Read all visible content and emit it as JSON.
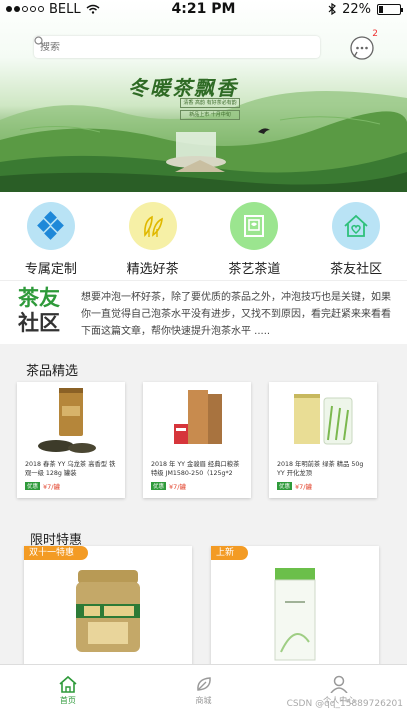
{
  "status_bar": {
    "carrier": "BELL",
    "time": "4:21 PM",
    "battery": "22%",
    "battery_level": 0.22
  },
  "search": {
    "placeholder": "搜索"
  },
  "messages": {
    "badge": "2"
  },
  "banner": {
    "title": "冬暖茶飘香",
    "subtitles": [
      "清香 高韵 有好茶必有韵",
      "新品上市 十月中旬"
    ]
  },
  "categories": [
    {
      "label": "专属定制",
      "icon": "diamond-grid-icon",
      "color": "#b9e3f5"
    },
    {
      "label": "精选好茶",
      "icon": "tea-leaf-icon",
      "color": "#f6f0a6"
    },
    {
      "label": "茶艺茶道",
      "icon": "tea-book-icon",
      "color": "#9be58f"
    },
    {
      "label": "茶友社区",
      "icon": "heart-home-icon",
      "color": "#b9e3f5"
    }
  ],
  "intro": {
    "logo_top": "茶友",
    "logo_bottom": "社区",
    "text": "想要冲泡一杯好茶，除了要优质的茶品之外，冲泡技巧也是关键，如果你一直觉得自己泡茶水平没有进步，又找不到原因，看完赶紧来来看看下面这篇文章，帮你快速提升泡茶水平 ....."
  },
  "featured": {
    "title": "茶品精选",
    "items": [
      {
        "name": "2018 春茶 YY 乌龙茶 高香型 铁观一级 128g 罐装",
        "tag": "优惠",
        "price": "¥7/罐"
      },
      {
        "name": "2018 年 YY 金骏眉 经典口粮茶特级 JM1580-250（125g*2",
        "tag": "优惠",
        "price": "¥7/罐"
      },
      {
        "name": "2018 年明前茶 绿茶 精品 50g YY 开化龙顶",
        "tag": "优惠",
        "price": "¥7/罐"
      }
    ]
  },
  "promo": {
    "title": "限时特惠",
    "items": [
      {
        "flag": "双十一特惠"
      },
      {
        "flag": "上新"
      }
    ]
  },
  "tabbar": {
    "items": [
      {
        "label": "首页",
        "icon": "home-icon"
      },
      {
        "label": "商城",
        "icon": "leaf-icon"
      },
      {
        "label": "个人中心",
        "icon": "user-icon"
      }
    ]
  },
  "watermark": "CSDN @qq_15889726201",
  "colors": {
    "brand_green": "#2e9a3a",
    "price_red": "#e3462f",
    "flag_orange": "#f39b24"
  }
}
